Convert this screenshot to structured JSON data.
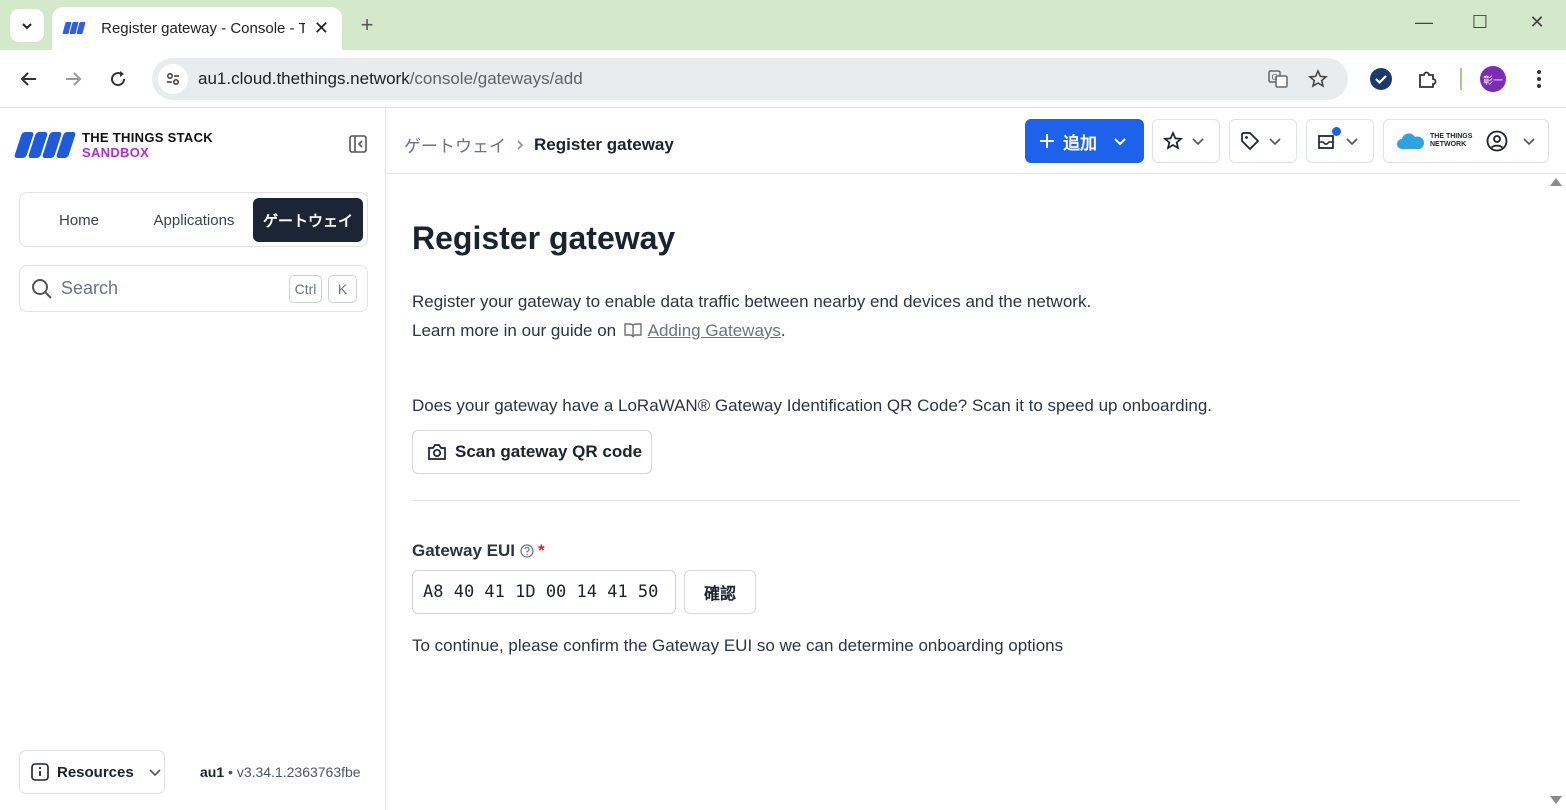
{
  "browser": {
    "tab_title": "Register gateway - Console - The Things Stack",
    "url_host": "au1.cloud.thethings.network",
    "url_path": "/console/gateways/add",
    "profile_initial": "彰一"
  },
  "sidebar": {
    "logo_line1": "THE THINGS STACK",
    "logo_line2": "SANDBOX",
    "switcher": [
      {
        "label": "Home"
      },
      {
        "label": "Applications"
      },
      {
        "label": "ゲートウェイ"
      }
    ],
    "search_placeholder": "Search",
    "kbd_ctrl": "Ctrl",
    "kbd_k": "K",
    "resources_label": "Resources",
    "version_cluster": "au1",
    "version_sep": " • ",
    "version_number": "v3.34.1.2363763fbe"
  },
  "header": {
    "breadcrumb": [
      "ゲートウェイ",
      "Register gateway"
    ],
    "add_label": "追加",
    "ttn_logo_line1": "THE THINGS",
    "ttn_logo_line2": "NETWORK"
  },
  "main": {
    "title": "Register gateway",
    "desc_line1": "Register your gateway to enable data traffic between nearby end devices and the network.",
    "desc_line2_prefix": "Learn more in our guide on",
    "desc_link": "Adding Gateways",
    "desc_suffix": ".",
    "qr_question": "Does your gateway have a LoRaWAN® Gateway Identification QR Code? Scan it to speed up onboarding.",
    "qr_button": "Scan gateway QR code",
    "eui_label": "Gateway EUI",
    "eui_required": "*",
    "eui_value": "A8 40 41 1D 00 14 41 50",
    "confirm_button": "確認",
    "hint": "To continue, please confirm the Gateway EUI so we can determine onboarding options"
  },
  "colors": {
    "accent": "#1e62ec",
    "nav_active": "#1c2535",
    "sandbox": "#b12cd8",
    "tabbar": "#d3e9c9",
    "required": "#e02424"
  }
}
